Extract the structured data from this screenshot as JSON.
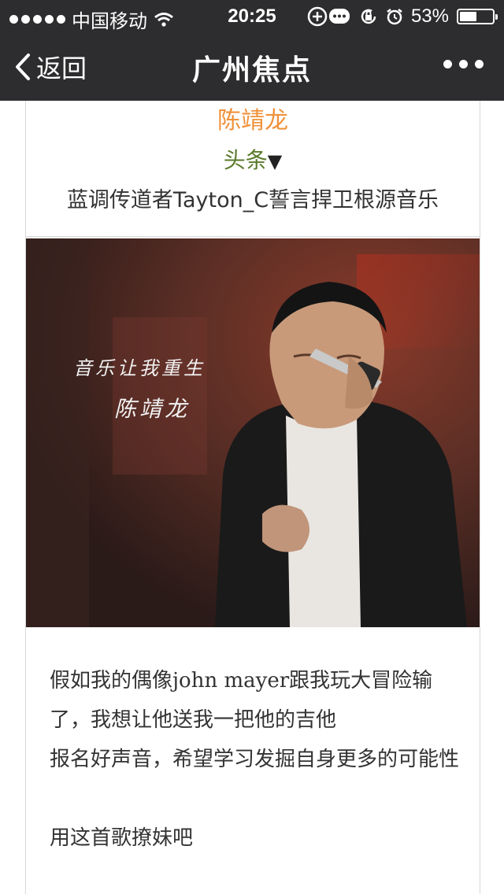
{
  "status_bar": {
    "carrier": "中国移动",
    "time": "20:25",
    "battery_percent": "53%",
    "battery_level": 0.53
  },
  "nav": {
    "back_label": "返回",
    "title": "广州焦点"
  },
  "article": {
    "author": "陈靖龙",
    "tag": "头条",
    "tag_arrow": "▼",
    "headline": "蓝调传道者Tayton_C誓言捍卫根源音乐",
    "photo_caption_line1": "音乐让我重生",
    "photo_caption_line2": "陈靖龙",
    "paragraphs": [
      "假如我的偶像john mayer跟我玩大冒险输了，我想让他送我一把他的吉他",
      "报名好声音，希望学习发掘自身更多的可能性",
      "",
      "用这首歌撩妹吧"
    ]
  },
  "colors": {
    "bar_bg": "#2d2d2f",
    "author": "#f0923a",
    "tag": "#5b7a2c"
  }
}
